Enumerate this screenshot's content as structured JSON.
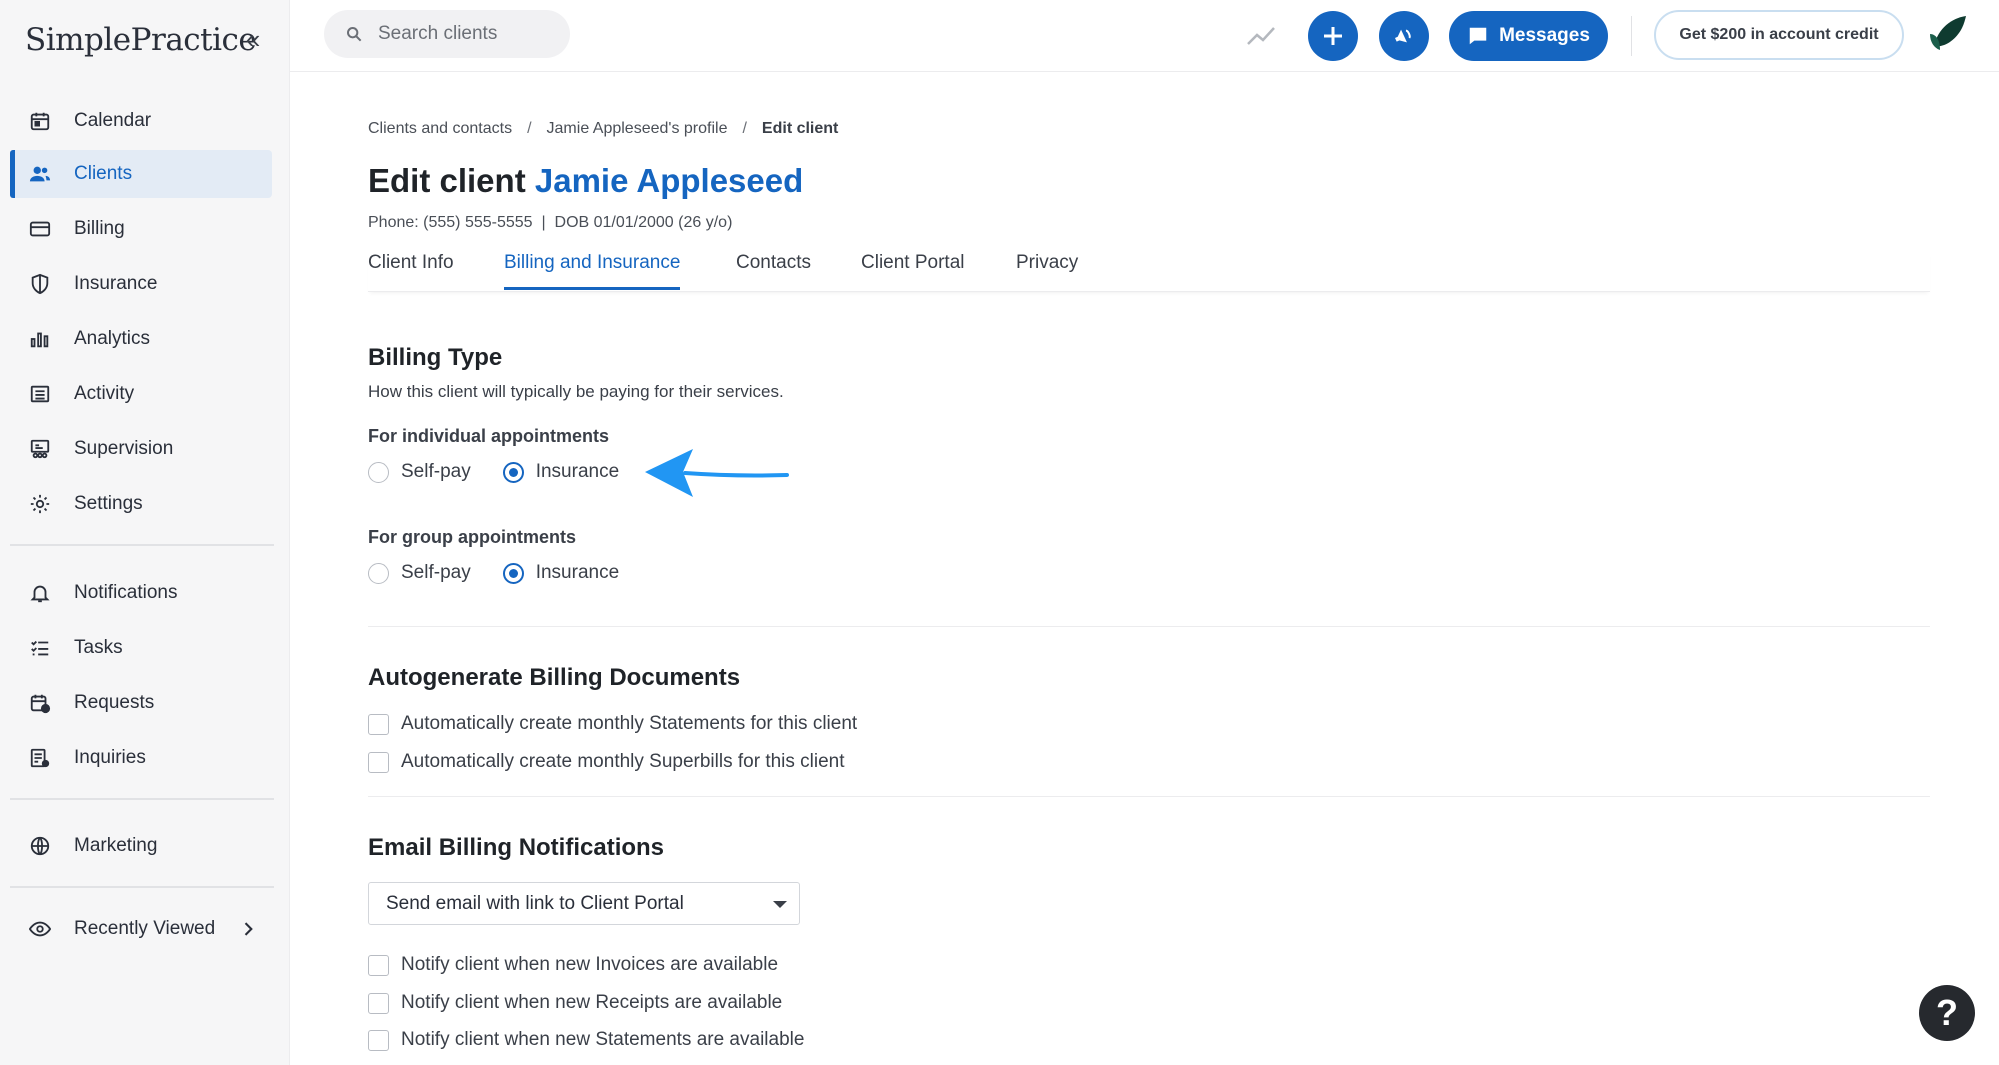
{
  "app": {
    "logo_text": "SimplePractice"
  },
  "sidebar": {
    "items": [
      {
        "label": "Calendar",
        "icon": "calendar-icon"
      },
      {
        "label": "Clients",
        "icon": "users-icon",
        "active": true
      },
      {
        "label": "Billing",
        "icon": "credit-card-icon"
      },
      {
        "label": "Insurance",
        "icon": "shield-icon"
      },
      {
        "label": "Analytics",
        "icon": "bar-chart-icon"
      },
      {
        "label": "Activity",
        "icon": "list-icon"
      },
      {
        "label": "Supervision",
        "icon": "supervision-icon"
      },
      {
        "label": "Settings",
        "icon": "gear-icon"
      },
      {
        "label": "Notifications",
        "icon": "bell-icon"
      },
      {
        "label": "Tasks",
        "icon": "checklist-icon"
      },
      {
        "label": "Requests",
        "icon": "calendar-clock-icon"
      },
      {
        "label": "Inquiries",
        "icon": "inquiry-icon"
      },
      {
        "label": "Marketing",
        "icon": "globe-icon"
      },
      {
        "label": "Recently Viewed",
        "icon": "eye-icon"
      }
    ]
  },
  "topbar": {
    "search_placeholder": "Search clients",
    "messages_label": "Messages",
    "credit_label": "Get $200 in account credit"
  },
  "breadcrumb": {
    "items": [
      "Clients and contacts",
      "Jamie Appleseed's profile",
      "Edit client"
    ],
    "separator": "/"
  },
  "page": {
    "title_prefix": "Edit client",
    "client_name": "Jamie Appleseed",
    "subinfo": "Phone: (555) 555-5555  |  DOB 01/01/2000 (26 y/o)"
  },
  "tabs": [
    {
      "label": "Client Info"
    },
    {
      "label": "Billing and Insurance",
      "active": true
    },
    {
      "label": "Contacts"
    },
    {
      "label": "Client Portal"
    },
    {
      "label": "Privacy"
    }
  ],
  "billing_type": {
    "title": "Billing Type",
    "description": "How this client will typically be paying for their services.",
    "individual": {
      "label": "For individual appointments",
      "options": [
        "Self-pay",
        "Insurance"
      ],
      "selected": "Insurance"
    },
    "group": {
      "label": "For group appointments",
      "options": [
        "Self-pay",
        "Insurance"
      ],
      "selected": "Insurance"
    }
  },
  "autogenerate": {
    "title": "Autogenerate Billing Documents",
    "options": [
      "Automatically create monthly Statements for this client",
      "Automatically create monthly Superbills for this client"
    ]
  },
  "email_notifications": {
    "title": "Email Billing Notifications",
    "select_value": "Send email with link to Client Portal",
    "options": [
      "Notify client when new Invoices are available",
      "Notify client when new Receipts are available",
      "Notify client when new Statements are available"
    ]
  },
  "help": {
    "label": "?"
  },
  "colors": {
    "accent": "#1565c0",
    "annotation_arrow": "#2196f3"
  }
}
